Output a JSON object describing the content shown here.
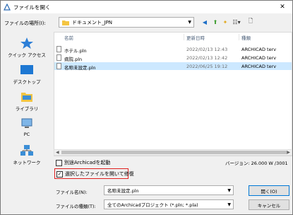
{
  "window": {
    "title": "ファイルを開く"
  },
  "lookin": {
    "label": "ファイルの場所(I):",
    "value": "ドキュメント_JPN"
  },
  "places": [
    {
      "label": "クイック アクセス",
      "icon": "star-icon"
    },
    {
      "label": "デスクトップ",
      "icon": "desktop-icon"
    },
    {
      "label": "ライブラリ",
      "icon": "library-icon"
    },
    {
      "label": "PC",
      "icon": "pc-icon"
    },
    {
      "label": "ネットワーク",
      "icon": "network-icon"
    }
  ],
  "columns": {
    "name": "名前",
    "modified": "更新日時",
    "type": "種類"
  },
  "files": [
    {
      "name": "ホテル.pln",
      "modified": "2022/02/13 12:43",
      "type": "ARCHICAD terv"
    },
    {
      "name": "病院.pln",
      "modified": "2022/02/13 12:42",
      "type": "ARCHICAD terv"
    },
    {
      "name": "名称未設定.pln",
      "modified": "2022/06/25 19:12",
      "type": "ARCHICAD terv"
    }
  ],
  "options": {
    "separate_label": "別途Archicadを起動",
    "separate_checked": false,
    "open_selected_label": "選択したファイルを開いて修復",
    "open_selected_checked": true
  },
  "version": "バージョン: 26.000 W /3001",
  "filename": {
    "label": "ファイル名(N):",
    "value": "名称未設定.pln"
  },
  "filetype": {
    "label": "ファイルの種類(T):",
    "value": "全てのArchicadプロジェクト (*.pln; *.pla)"
  },
  "buttons": {
    "open": "開く(O)",
    "cancel": "キャンセル"
  },
  "colors": {
    "selection": "#cce8ff",
    "highlight": "#e0201f",
    "accent": "#0078d7"
  }
}
